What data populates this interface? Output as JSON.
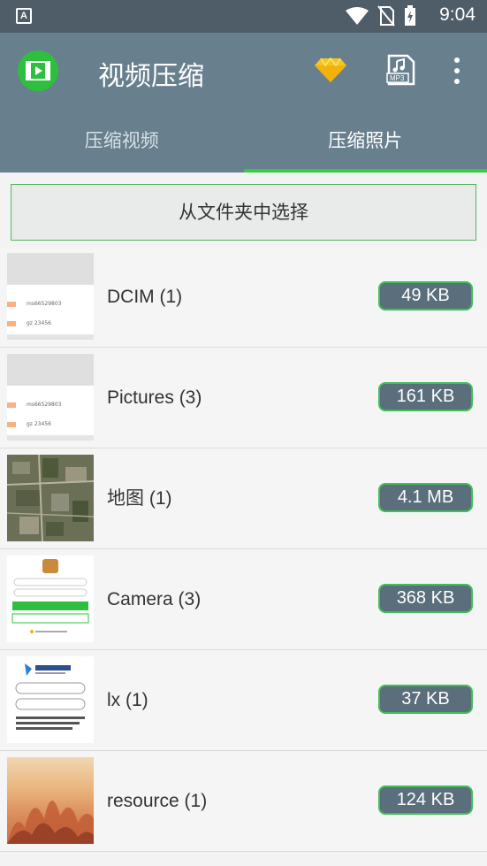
{
  "status_bar": {
    "left_icon_letter": "A",
    "time": "9:04"
  },
  "app_bar": {
    "title": "视频压缩",
    "mp3_label": "MP3"
  },
  "tabs": [
    {
      "label": "压缩视频",
      "active": false
    },
    {
      "label": "压缩照片",
      "active": true
    }
  ],
  "select_button_label": "从文件夹中选择",
  "folders": [
    {
      "label": "DCIM (1)",
      "size": "49 KB",
      "thumb": "document"
    },
    {
      "label": "Pictures (3)",
      "size": "161 KB",
      "thumb": "document"
    },
    {
      "label": "地图 (1)",
      "size": "4.1 MB",
      "thumb": "map"
    },
    {
      "label": "Camera (3)",
      "size": "368 KB",
      "thumb": "login-screen"
    },
    {
      "label": "lx (1)",
      "size": "37 KB",
      "thumb": "form-screen"
    },
    {
      "label": "resource (1)",
      "size": "124 KB",
      "thumb": "fire-painting"
    }
  ],
  "colors": {
    "status_bar": "#4f5d68",
    "app_bar": "#687f8e",
    "accent_green": "#33cc44",
    "badge_bg": "#5a6e7b"
  }
}
